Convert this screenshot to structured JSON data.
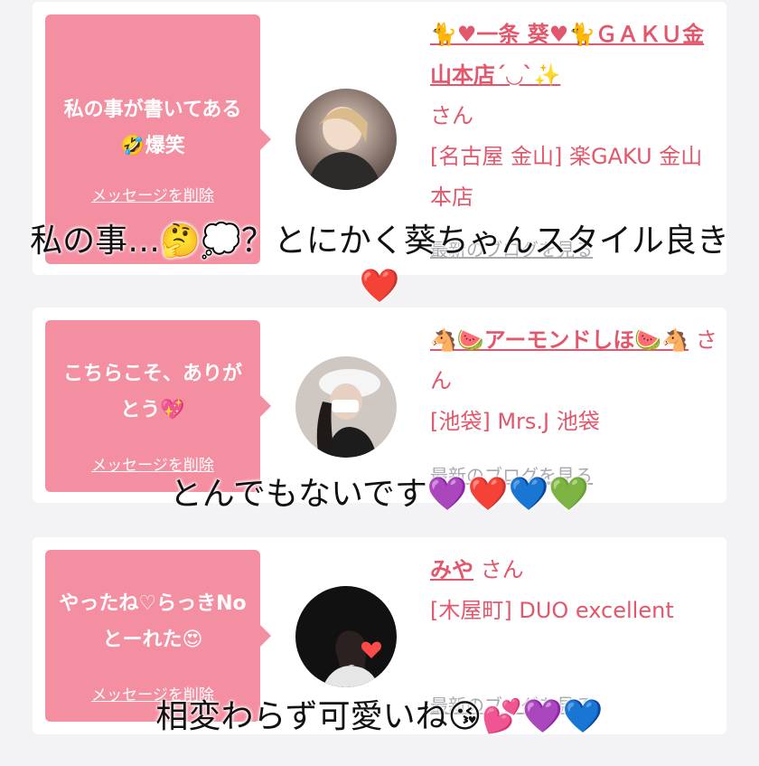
{
  "colors": {
    "accent": "#e2576b",
    "bubble": "#f48ea1",
    "muted": "#a8a8ae",
    "card": "#ffffff",
    "page": "#f3f3f5"
  },
  "cards": [
    {
      "message": "私の事が書いてある🤣爆笑",
      "delete_label": "メッセージを削除",
      "avatar_icon": "user-photo-icon",
      "name": "🐈♥一条 葵♥🐈ＧＡＫＵ金山本店´◡`✨",
      "san": "さん",
      "shop": "[名古屋 金山] 楽GAKU 金山本店",
      "blog_label": "最新のブログを見る",
      "caption": "私の事…🤔💭？とにかく葵ちゃんスタイル良き❤️"
    },
    {
      "message": "こちらこそ、ありがとう💖",
      "delete_label": "メッセージを削除",
      "avatar_icon": "user-photo-icon",
      "name": "🐴🍉アーモンドしほ🍉🐴",
      "san": "さん",
      "shop": "[池袋] Mrs.J 池袋",
      "blog_label": "最新のブログを見る",
      "caption": "とんでもないです💜❤️💙💚"
    },
    {
      "message": "やったね♡らっきNoとーれた😍",
      "delete_label": "メッセージを削除",
      "avatar_icon": "user-photo-icon",
      "name": "みや",
      "san": "さん",
      "shop": "[木屋町] DUO excellent",
      "blog_label": "最新のブログを見る",
      "caption": "相変わらず可愛いね😘💕💜💙"
    }
  ]
}
